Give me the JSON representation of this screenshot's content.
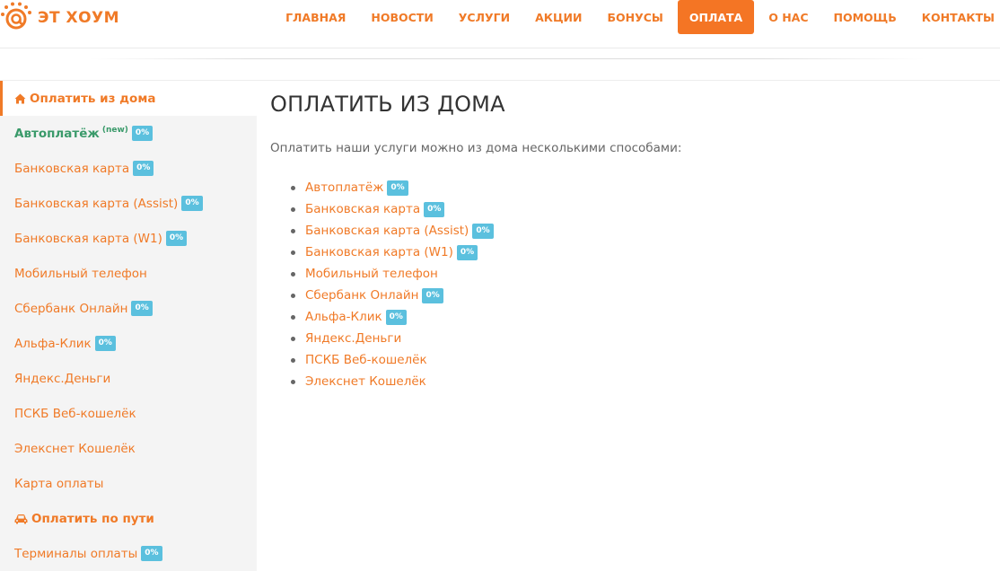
{
  "header": {
    "logo_text": "ЭТ ХОУМ",
    "nav": [
      {
        "label": "ГЛАВНАЯ",
        "active": false
      },
      {
        "label": "НОВОСТИ",
        "active": false
      },
      {
        "label": "УСЛУГИ",
        "active": false
      },
      {
        "label": "АКЦИИ",
        "active": false
      },
      {
        "label": "БОНУСЫ",
        "active": false
      },
      {
        "label": "ОПЛАТА",
        "active": true
      },
      {
        "label": "О НАС",
        "active": false
      },
      {
        "label": "ПОМОЩЬ",
        "active": false
      },
      {
        "label": "КОНТАКТЫ",
        "active": false
      }
    ]
  },
  "sidebar": {
    "items": [
      {
        "label": "Оплатить из дома",
        "type": "section",
        "icon": "home-icon",
        "active": true
      },
      {
        "label": "Автоплатёж",
        "sup": "(new)",
        "badge": "0%",
        "type": "green"
      },
      {
        "label": "Банковская карта",
        "badge": "0%"
      },
      {
        "label": "Банковская карта (Assist)",
        "badge": "0%"
      },
      {
        "label": "Банковская карта (W1)",
        "badge": "0%"
      },
      {
        "label": "Мобильный телефон"
      },
      {
        "label": "Сбербанк Онлайн",
        "badge": "0%"
      },
      {
        "label": "Альфа-Клик",
        "badge": "0%"
      },
      {
        "label": "Яндекс.Деньги"
      },
      {
        "label": "ПСКБ Веб-кошелёк"
      },
      {
        "label": "Элекснет Кошелёк"
      },
      {
        "label": "Карта оплаты"
      },
      {
        "label": "Оплатить по пути",
        "type": "section",
        "icon": "car-icon"
      },
      {
        "label": "Терминалы оплаты",
        "badge": "0%"
      }
    ]
  },
  "main": {
    "title": "ОПЛАТИТЬ ИЗ ДОМА",
    "intro": "Оплатить наши услуги можно из дома несколькими способами:",
    "methods": [
      {
        "label": "Автоплатёж",
        "badge": "0%"
      },
      {
        "label": "Банковская карта",
        "badge": "0%"
      },
      {
        "label": "Банковская карта (Assist)",
        "badge": "0%"
      },
      {
        "label": "Банковская карта (W1)",
        "badge": "0%"
      },
      {
        "label": "Мобильный телефон"
      },
      {
        "label": "Сбербанк Онлайн",
        "badge": "0%"
      },
      {
        "label": "Альфа-Клик",
        "badge": "0%"
      },
      {
        "label": "Яндекс.Деньги"
      },
      {
        "label": "ПСКБ Веб-кошелёк"
      },
      {
        "label": "Элекснет Кошелёк"
      }
    ]
  },
  "colors": {
    "accent": "#f07a27",
    "active_nav_bg": "#f47524",
    "badge": "#5bc0de",
    "green": "#3a9a6a",
    "sidebar_bg": "#f4f4f4"
  }
}
